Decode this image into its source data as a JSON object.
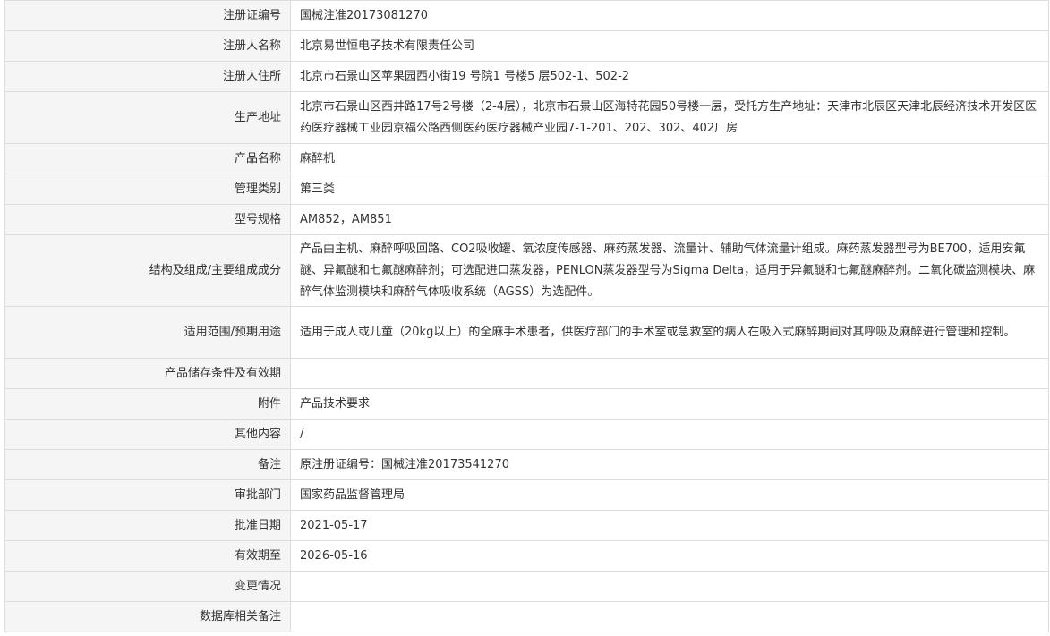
{
  "rows": [
    {
      "label": "注册证编号",
      "value": "国械注准20173081270"
    },
    {
      "label": "注册人名称",
      "value": "北京易世恒电子技术有限责任公司"
    },
    {
      "label": "注册人住所",
      "value": "北京市石景山区苹果园西小街19 号院1 号楼5 层502-1、502-2"
    },
    {
      "label": "生产地址",
      "value": "北京市石景山区西井路17号2号楼（2-4层），北京市石景山区海特花园50号楼一层，受托方生产地址：天津市北辰区天津北辰经济技术开发区医药医疗器械工业园京福公路西侧医药医疗器械产业园7-1-201、202、302、402厂房"
    },
    {
      "label": "产品名称",
      "value": "麻醉机"
    },
    {
      "label": "管理类别",
      "value": "第三类"
    },
    {
      "label": "型号规格",
      "value": "AM852，AM851"
    },
    {
      "label": "结构及组成/主要组成成分",
      "value": "产品由主机、麻醉呼吸回路、CO2吸收罐、氧浓度传感器、麻药蒸发器、流量计、辅助气体流量计组成。麻药蒸发器型号为BE700，适用安氟醚、异氟醚和七氟醚麻醉剂；可选配进口蒸发器，PENLON蒸发器型号为Sigma Delta，适用于异氟醚和七氟醚麻醉剂。二氧化碳监测模块、麻醉气体监测模块和麻醉气体吸收系统（AGSS）为选配件。"
    },
    {
      "label": "适用范围/预期用途",
      "value": "适用于成人或儿童（20kg以上）的全麻手术患者，供医疗部门的手术室或急救室的病人在吸入式麻醉期间对其呼吸及麻醉进行管理和控制。"
    },
    {
      "label": "产品储存条件及有效期",
      "value": ""
    },
    {
      "label": "附件",
      "value": "产品技术要求"
    },
    {
      "label": "其他内容",
      "value": "/"
    },
    {
      "label": "备注",
      "value": "原注册证编号：国械注准20173541270"
    },
    {
      "label": "审批部门",
      "value": "国家药品监督管理局"
    },
    {
      "label": "批准日期",
      "value": "2021-05-17"
    },
    {
      "label": "有效期至",
      "value": "2026-05-16"
    },
    {
      "label": "变更情况",
      "value": ""
    },
    {
      "label": "数据库相关备注",
      "value": ""
    }
  ]
}
